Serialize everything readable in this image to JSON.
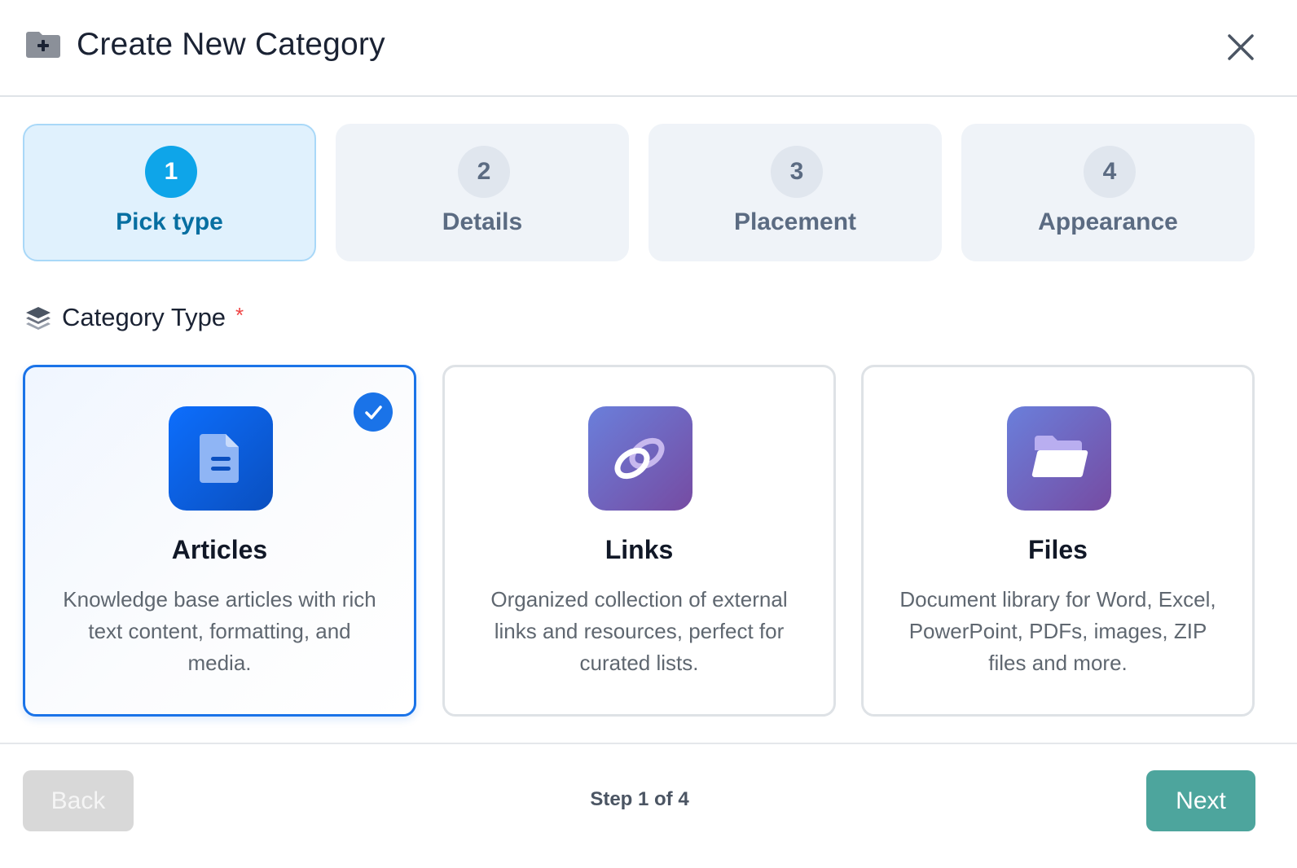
{
  "dialog": {
    "title": "Create New Category",
    "header_icon": "folder-plus-icon",
    "close_icon": "close-icon"
  },
  "steps": [
    {
      "number": "1",
      "label": "Pick type",
      "active": true
    },
    {
      "number": "2",
      "label": "Details",
      "active": false
    },
    {
      "number": "3",
      "label": "Placement",
      "active": false
    },
    {
      "number": "4",
      "label": "Appearance",
      "active": false
    }
  ],
  "section": {
    "label": "Category Type",
    "required_marker": "*",
    "icon": "layers-icon"
  },
  "types": [
    {
      "title": "Articles",
      "description": "Knowledge base articles with rich text content, formatting, and media.",
      "icon": "document-icon",
      "selected": true
    },
    {
      "title": "Links",
      "description": "Organized collection of external links and resources, perfect for curated lists.",
      "icon": "link-icon",
      "selected": false
    },
    {
      "title": "Files",
      "description": "Document library for Word, Excel, PowerPoint, PDFs, images, ZIP files and more.",
      "icon": "folder-open-icon",
      "selected": false
    }
  ],
  "footer": {
    "back_label": "Back",
    "step_indicator": "Step 1 of 4",
    "next_label": "Next"
  },
  "colors": {
    "accent_blue": "#1a73e8",
    "step_active": "#0ea5e9",
    "next_button": "#4da59d",
    "required": "#ef4444"
  }
}
